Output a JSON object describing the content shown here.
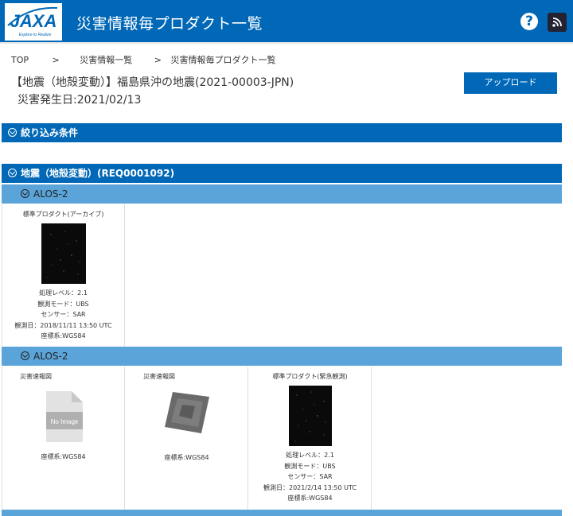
{
  "header": {
    "title": "災害情報毎プロダクト一覧",
    "logo_text": "JAXA",
    "logo_tagline": "Explore to Realize"
  },
  "breadcrumb": {
    "top": "TOP",
    "sep1": ">",
    "mid": "災害情報一覧",
    "sep2": ">",
    "current": "災害情報毎プロダクト一覧"
  },
  "disaster": {
    "title": "【地震（地殻変動）】福島県沖の地震(2021-00003-JPN)",
    "date": "災害発生日:2021/02/13"
  },
  "upload_label": "アップロード",
  "filter_label": "絞り込み条件",
  "group_label": "地震（地殻変動）(REQ0001092)",
  "section1": {
    "label": "ALOS-2",
    "cards": [
      {
        "title": "標準プロダクト(アーカイブ)",
        "level": "処理レベル：2.1",
        "mode": "観測モード：UBS",
        "sensor": "センサー：SAR",
        "obs": "観測日：2018/11/11 13:50 UTC",
        "crs": "座標系:WGS84"
      }
    ]
  },
  "section2": {
    "label": "ALOS-2",
    "cards": [
      {
        "title": "災害速報図",
        "noimage": "No Image",
        "crs": "座標系:WGS84"
      },
      {
        "title": "災害速報図",
        "crs": "座標系:WGS84"
      },
      {
        "title": "標準プロダクト(緊急観測)",
        "level": "処理レベル：2.1",
        "mode": "観測モード：UBS",
        "sensor": "センサー：SAR",
        "obs": "観測日：2021/2/14 13:50 UTC",
        "crs": "座標系:WGS84"
      }
    ]
  },
  "colors": {
    "primary": "#0068b7",
    "secondary": "#5ba4d9"
  }
}
